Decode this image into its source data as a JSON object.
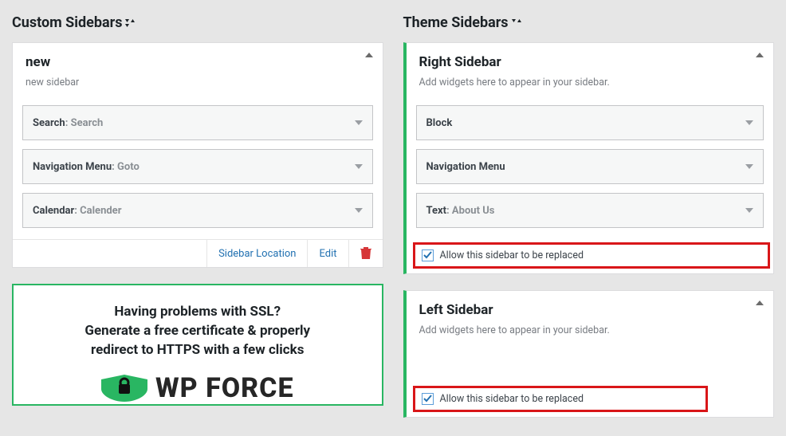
{
  "custom_section_title": "Custom Sidebars",
  "theme_section_title": "Theme Sidebars",
  "custom": {
    "title": "new",
    "desc": "new sidebar",
    "widgets": [
      {
        "name": "Search",
        "instance": "Search"
      },
      {
        "name": "Navigation Menu",
        "instance": "Goto"
      },
      {
        "name": "Calendar",
        "instance": "Calender"
      }
    ],
    "actions": {
      "location": "Sidebar Location",
      "edit": "Edit"
    }
  },
  "theme": {
    "right": {
      "title": "Right Sidebar",
      "desc": "Add widgets here to appear in your sidebar.",
      "widgets": [
        {
          "name": "Block",
          "instance": ""
        },
        {
          "name": "Navigation Menu",
          "instance": ""
        },
        {
          "name": "Text",
          "instance": "About Us"
        }
      ],
      "allow_label": "Allow this sidebar to be replaced"
    },
    "left": {
      "title": "Left Sidebar",
      "desc": "Add widgets here to appear in your sidebar.",
      "allow_label": "Allow this sidebar to be replaced"
    }
  },
  "promo": {
    "line1": "Having problems with SSL?",
    "line2": "Generate a free certificate & properly",
    "line3": "redirect to HTTPS with a few clicks",
    "brand": "WP FORCE"
  }
}
